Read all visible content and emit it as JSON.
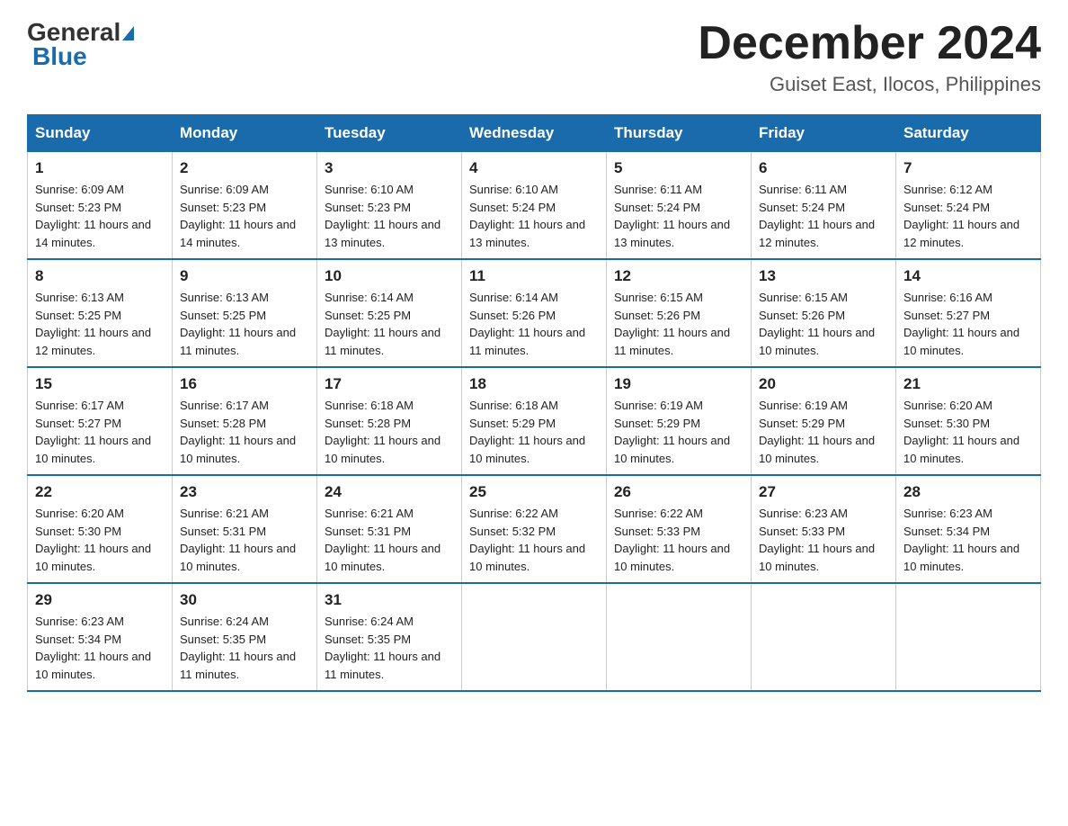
{
  "header": {
    "logo_general": "General",
    "logo_blue": "Blue",
    "month_title": "December 2024",
    "subtitle": "Guiset East, Ilocos, Philippines"
  },
  "days_of_week": [
    "Sunday",
    "Monday",
    "Tuesday",
    "Wednesday",
    "Thursday",
    "Friday",
    "Saturday"
  ],
  "weeks": [
    [
      {
        "day": "1",
        "sunrise": "6:09 AM",
        "sunset": "5:23 PM",
        "daylight": "11 hours and 14 minutes."
      },
      {
        "day": "2",
        "sunrise": "6:09 AM",
        "sunset": "5:23 PM",
        "daylight": "11 hours and 14 minutes."
      },
      {
        "day": "3",
        "sunrise": "6:10 AM",
        "sunset": "5:23 PM",
        "daylight": "11 hours and 13 minutes."
      },
      {
        "day": "4",
        "sunrise": "6:10 AM",
        "sunset": "5:24 PM",
        "daylight": "11 hours and 13 minutes."
      },
      {
        "day": "5",
        "sunrise": "6:11 AM",
        "sunset": "5:24 PM",
        "daylight": "11 hours and 13 minutes."
      },
      {
        "day": "6",
        "sunrise": "6:11 AM",
        "sunset": "5:24 PM",
        "daylight": "11 hours and 12 minutes."
      },
      {
        "day": "7",
        "sunrise": "6:12 AM",
        "sunset": "5:24 PM",
        "daylight": "11 hours and 12 minutes."
      }
    ],
    [
      {
        "day": "8",
        "sunrise": "6:13 AM",
        "sunset": "5:25 PM",
        "daylight": "11 hours and 12 minutes."
      },
      {
        "day": "9",
        "sunrise": "6:13 AM",
        "sunset": "5:25 PM",
        "daylight": "11 hours and 11 minutes."
      },
      {
        "day": "10",
        "sunrise": "6:14 AM",
        "sunset": "5:25 PM",
        "daylight": "11 hours and 11 minutes."
      },
      {
        "day": "11",
        "sunrise": "6:14 AM",
        "sunset": "5:26 PM",
        "daylight": "11 hours and 11 minutes."
      },
      {
        "day": "12",
        "sunrise": "6:15 AM",
        "sunset": "5:26 PM",
        "daylight": "11 hours and 11 minutes."
      },
      {
        "day": "13",
        "sunrise": "6:15 AM",
        "sunset": "5:26 PM",
        "daylight": "11 hours and 10 minutes."
      },
      {
        "day": "14",
        "sunrise": "6:16 AM",
        "sunset": "5:27 PM",
        "daylight": "11 hours and 10 minutes."
      }
    ],
    [
      {
        "day": "15",
        "sunrise": "6:17 AM",
        "sunset": "5:27 PM",
        "daylight": "11 hours and 10 minutes."
      },
      {
        "day": "16",
        "sunrise": "6:17 AM",
        "sunset": "5:28 PM",
        "daylight": "11 hours and 10 minutes."
      },
      {
        "day": "17",
        "sunrise": "6:18 AM",
        "sunset": "5:28 PM",
        "daylight": "11 hours and 10 minutes."
      },
      {
        "day": "18",
        "sunrise": "6:18 AM",
        "sunset": "5:29 PM",
        "daylight": "11 hours and 10 minutes."
      },
      {
        "day": "19",
        "sunrise": "6:19 AM",
        "sunset": "5:29 PM",
        "daylight": "11 hours and 10 minutes."
      },
      {
        "day": "20",
        "sunrise": "6:19 AM",
        "sunset": "5:29 PM",
        "daylight": "11 hours and 10 minutes."
      },
      {
        "day": "21",
        "sunrise": "6:20 AM",
        "sunset": "5:30 PM",
        "daylight": "11 hours and 10 minutes."
      }
    ],
    [
      {
        "day": "22",
        "sunrise": "6:20 AM",
        "sunset": "5:30 PM",
        "daylight": "11 hours and 10 minutes."
      },
      {
        "day": "23",
        "sunrise": "6:21 AM",
        "sunset": "5:31 PM",
        "daylight": "11 hours and 10 minutes."
      },
      {
        "day": "24",
        "sunrise": "6:21 AM",
        "sunset": "5:31 PM",
        "daylight": "11 hours and 10 minutes."
      },
      {
        "day": "25",
        "sunrise": "6:22 AM",
        "sunset": "5:32 PM",
        "daylight": "11 hours and 10 minutes."
      },
      {
        "day": "26",
        "sunrise": "6:22 AM",
        "sunset": "5:33 PM",
        "daylight": "11 hours and 10 minutes."
      },
      {
        "day": "27",
        "sunrise": "6:23 AM",
        "sunset": "5:33 PM",
        "daylight": "11 hours and 10 minutes."
      },
      {
        "day": "28",
        "sunrise": "6:23 AM",
        "sunset": "5:34 PM",
        "daylight": "11 hours and 10 minutes."
      }
    ],
    [
      {
        "day": "29",
        "sunrise": "6:23 AM",
        "sunset": "5:34 PM",
        "daylight": "11 hours and 10 minutes."
      },
      {
        "day": "30",
        "sunrise": "6:24 AM",
        "sunset": "5:35 PM",
        "daylight": "11 hours and 11 minutes."
      },
      {
        "day": "31",
        "sunrise": "6:24 AM",
        "sunset": "5:35 PM",
        "daylight": "11 hours and 11 minutes."
      },
      null,
      null,
      null,
      null
    ]
  ],
  "labels": {
    "sunrise": "Sunrise:",
    "sunset": "Sunset:",
    "daylight": "Daylight:"
  }
}
